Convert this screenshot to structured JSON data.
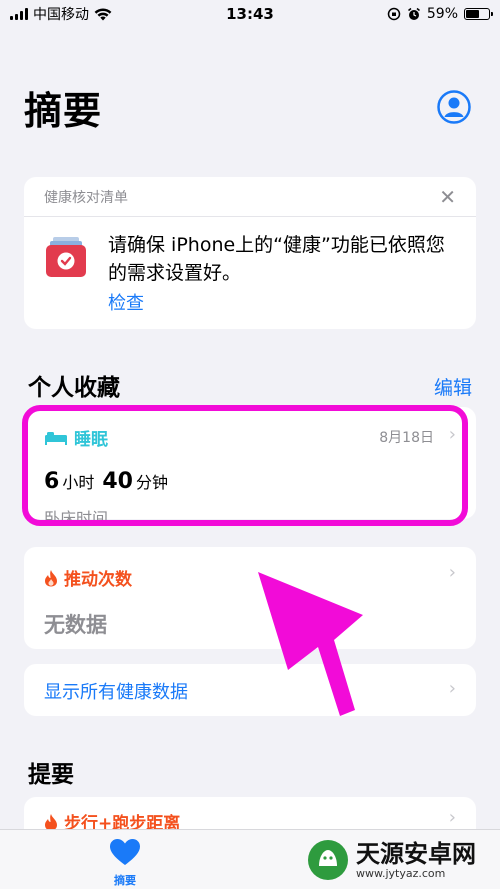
{
  "status_bar": {
    "carrier": "中国移动",
    "time": "13:43",
    "battery": "59%",
    "battery_level": 0.59
  },
  "header": {
    "title": "摘要",
    "avatar_icon": "person-circle-icon"
  },
  "checklist": {
    "title": "健康核对清单",
    "close_icon": "close-icon",
    "close_glyph": "✕",
    "message": "请确保 iPhone上的“健康”功能已依照您的需求设置好。",
    "link": "检查"
  },
  "favorites": {
    "title": "个人收藏",
    "edit_label": "编辑",
    "sleep": {
      "label": "睡眠",
      "icon": "bed-icon",
      "date": "8月18日",
      "hours": "6",
      "hours_unit": "小时",
      "minutes": "40",
      "minutes_unit": "分钟",
      "subtitle": "卧床时间"
    },
    "pushes": {
      "label": "推动次数",
      "icon": "flame-icon",
      "value": "无数据"
    },
    "show_all": "显示所有健康数据"
  },
  "highlights": {
    "title": "提要",
    "first_item": "步行+跑步距离",
    "first_item_icon": "flame-icon"
  },
  "tab_bar": {
    "summary_label": "摘要",
    "summary_icon": "heart-icon"
  },
  "watermark": {
    "text": "天源安卓网",
    "url": "www.jytyaz.com"
  },
  "colors": {
    "accent": "#1a7af8",
    "sleep": "#30c5d8",
    "activity": "#f4511e",
    "annotation": "#f20bd8",
    "background": "#f2f2f7"
  },
  "chevron_glyph": "›"
}
